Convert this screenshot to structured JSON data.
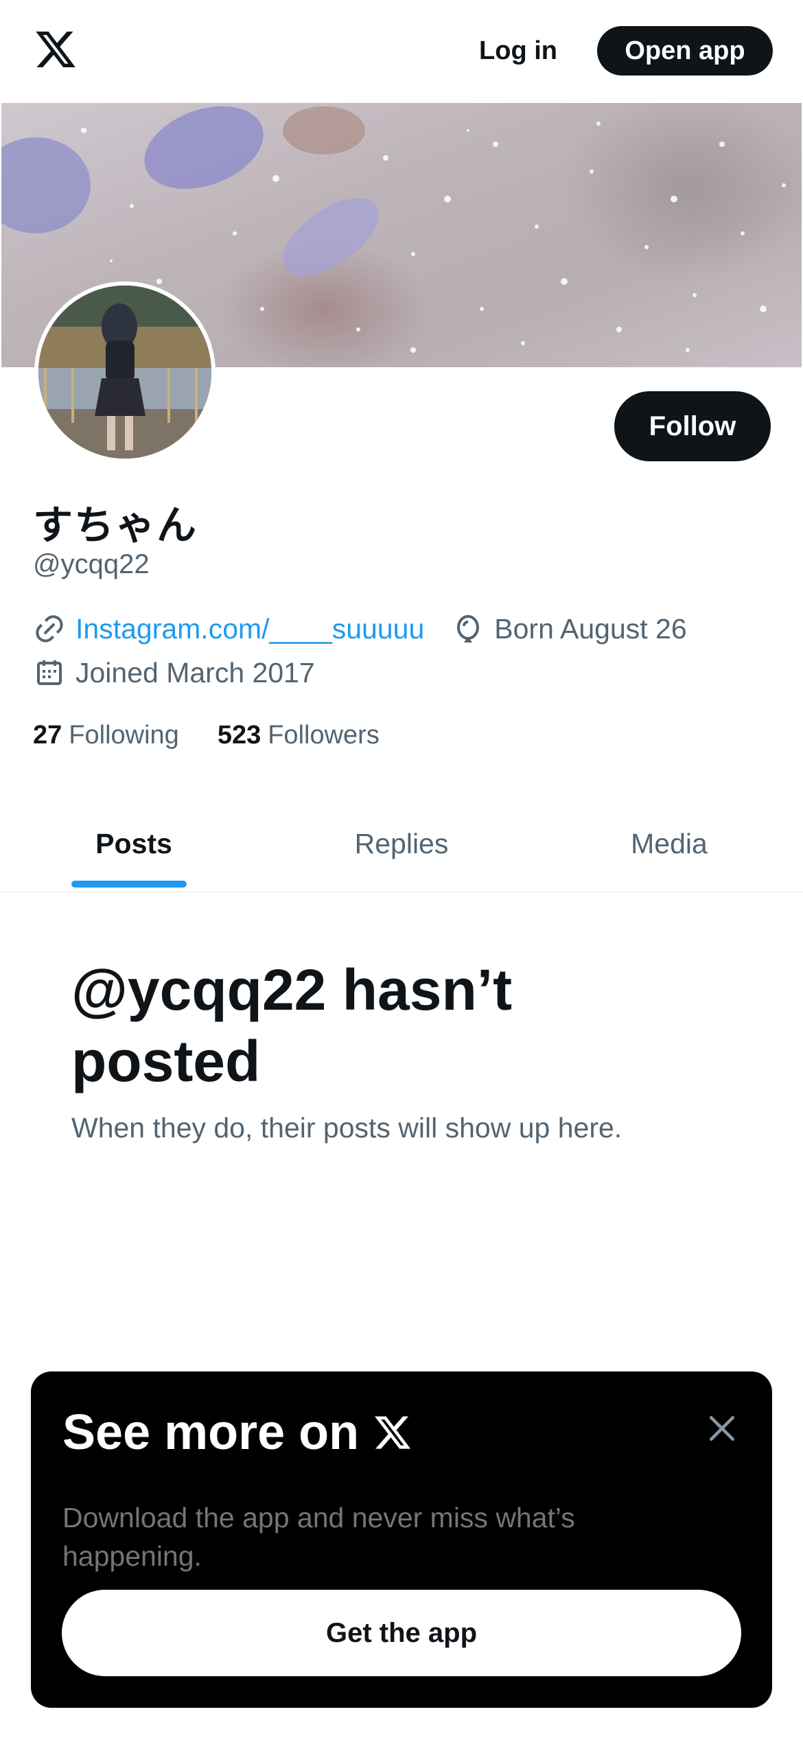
{
  "header": {
    "logo_icon": "x-logo-icon",
    "login_label": "Log in",
    "open_app_label": "Open app"
  },
  "profile": {
    "display_name": "すちゃん",
    "handle": "@ycqq22",
    "follow_label": "Follow",
    "website": "Instagram.com/____suuuuu",
    "birthday": "Born August 26",
    "joined": "Joined March 2017",
    "following_count": "27",
    "following_label": "Following",
    "followers_count": "523",
    "followers_label": "Followers"
  },
  "tabs": [
    {
      "label": "Posts",
      "active": true
    },
    {
      "label": "Replies",
      "active": false
    },
    {
      "label": "Media",
      "active": false
    }
  ],
  "empty_state": {
    "title": "@ycqq22 hasn’t posted",
    "subtitle": "When they do, their posts will show up here."
  },
  "promo": {
    "title": "See more on",
    "subtitle": "Download the app and never miss what’s happening.",
    "cta_label": "Get the app"
  },
  "colors": {
    "accent": "#1d9bf0",
    "text_primary": "#0f1419",
    "text_secondary": "#536471",
    "button_dark": "#0f1419"
  }
}
